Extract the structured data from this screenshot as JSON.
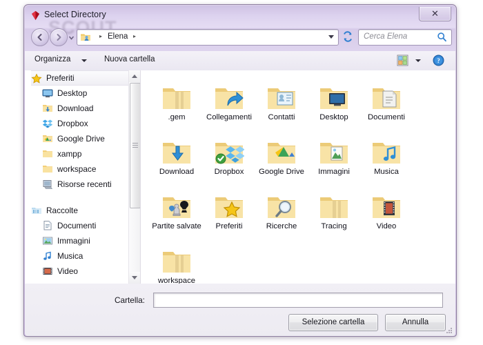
{
  "window": {
    "title": "Select Directory",
    "title_icon": "ruby-gem-icon",
    "ghost_text": "SCOUT",
    "close_label": "✕"
  },
  "navigation": {
    "back_icon": "back-arrow-icon",
    "forward_icon": "forward-arrow-icon",
    "history_icon": "chevron-down-icon",
    "breadcrumb": [
      "Elena"
    ],
    "breadcrumb_separator": "▸",
    "address_dropdown_icon": "chevron-down-icon",
    "refresh_icon": "refresh-icon"
  },
  "search": {
    "placeholder": "Cerca Elena",
    "icon": "search-icon"
  },
  "toolbar": {
    "organize_label": "Organizza",
    "new_folder_label": "Nuova cartella",
    "view_icon": "view-options-icon",
    "view_caret_icon": "chevron-down-icon",
    "help_icon": "help-icon"
  },
  "sidebar": {
    "groups": [
      {
        "header": "Preferiti",
        "header_icon": "star-icon",
        "selected": true,
        "items": [
          {
            "label": "Desktop",
            "icon": "desktop-icon"
          },
          {
            "label": "Download",
            "icon": "download-folder-icon"
          },
          {
            "label": "Dropbox",
            "icon": "dropbox-icon"
          },
          {
            "label": "Google Drive",
            "icon": "google-drive-folder-icon"
          },
          {
            "label": "xampp",
            "icon": "folder-icon"
          },
          {
            "label": "workspace",
            "icon": "folder-icon"
          },
          {
            "label": "Risorse recenti",
            "icon": "recent-places-icon"
          }
        ]
      },
      {
        "header": "Raccolte",
        "header_icon": "libraries-icon",
        "selected": false,
        "items": [
          {
            "label": "Documenti",
            "icon": "documents-icon"
          },
          {
            "label": "Immagini",
            "icon": "pictures-icon"
          },
          {
            "label": "Musica",
            "icon": "music-icon"
          },
          {
            "label": "Video",
            "icon": "video-icon"
          }
        ]
      }
    ]
  },
  "files": {
    "items": [
      {
        "name": ".gem",
        "icon": "folder-icon"
      },
      {
        "name": "Collegamenti",
        "icon": "shortcut-folder-icon"
      },
      {
        "name": "Contatti",
        "icon": "contacts-folder-icon"
      },
      {
        "name": "Desktop",
        "icon": "desktop-folder-icon"
      },
      {
        "name": "Documenti",
        "icon": "documents-folder-icon"
      },
      {
        "name": "Download",
        "icon": "download-folder-icon"
      },
      {
        "name": "Dropbox",
        "icon": "dropbox-folder-icon"
      },
      {
        "name": "Google Drive",
        "icon": "google-drive-folder-icon"
      },
      {
        "name": "Immagini",
        "icon": "pictures-folder-icon"
      },
      {
        "name": "Musica",
        "icon": "music-folder-icon"
      },
      {
        "name": "Partite salvate",
        "icon": "saved-games-folder-icon"
      },
      {
        "name": "Preferiti",
        "icon": "favorites-folder-icon"
      },
      {
        "name": "Ricerche",
        "icon": "searches-folder-icon"
      },
      {
        "name": "Tracing",
        "icon": "folder-icon"
      },
      {
        "name": "Video",
        "icon": "video-folder-icon"
      },
      {
        "name": "workspace",
        "icon": "folder-icon"
      }
    ]
  },
  "footer": {
    "folder_label": "Cartella:",
    "folder_value": "",
    "select_button": "Selezione cartella",
    "cancel_button": "Annulla"
  },
  "colors": {
    "frame": "#cfc0e2",
    "accent_blue": "#2a7fd4",
    "folder_yellow": "#f7d98a"
  }
}
